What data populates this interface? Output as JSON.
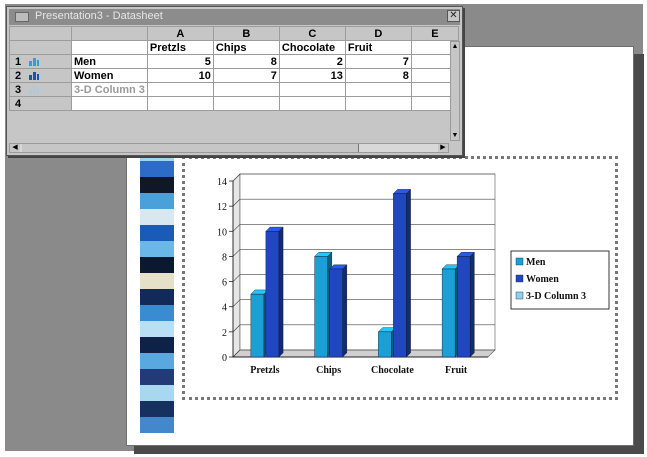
{
  "window": {
    "title": "Presentation3 - Datasheet",
    "close_glyph": "✕"
  },
  "datasheet": {
    "columns": [
      "A",
      "B",
      "C",
      "D",
      "E"
    ],
    "categories": [
      "Pretzls",
      "Chips",
      "Chocolate",
      "Fruit",
      ""
    ],
    "rows": [
      {
        "num": "1",
        "label": "Men",
        "values": [
          "5",
          "8",
          "2",
          "7",
          ""
        ],
        "color": "#29a3d6",
        "dim": false
      },
      {
        "num": "2",
        "label": "Women",
        "values": [
          "10",
          "7",
          "13",
          "8",
          ""
        ],
        "color": "#1f4fb8",
        "dim": false
      },
      {
        "num": "3",
        "label": "3-D Column 3",
        "values": [
          "",
          "",
          "",
          "",
          ""
        ],
        "color": "#8fd0ee",
        "dim": true
      },
      {
        "num": "4",
        "label": "",
        "values": [
          "",
          "",
          "",
          "",
          ""
        ],
        "color": "",
        "dim": false
      }
    ]
  },
  "stripe_colors": [
    "#9fd4f2",
    "#2c6cc8",
    "#101828",
    "#4aa0d8",
    "#d8e8f0",
    "#1a5bb8",
    "#6ab8e8",
    "#0a1830",
    "#e6e0c8",
    "#122a58",
    "#3a8cd0",
    "#b8dff4",
    "#0e2248",
    "#5aa8e0",
    "#223a78",
    "#a8d8f0",
    "#163060",
    "#4488cc"
  ],
  "chart_data": {
    "type": "bar",
    "categories": [
      "Pretzls",
      "Chips",
      "Chocolate",
      "Fruit"
    ],
    "series": [
      {
        "name": "Men",
        "values": [
          5,
          8,
          2,
          7
        ],
        "color": "#1a9fd6"
      },
      {
        "name": "Women",
        "values": [
          10,
          7,
          13,
          8
        ],
        "color": "#2047c0"
      }
    ],
    "legend": [
      "Men",
      "Women",
      "3-D Column 3"
    ],
    "legend_colors": [
      "#1a9fd6",
      "#2047c0",
      "#8fd0ee"
    ],
    "ylim": [
      0,
      14
    ],
    "yticks": [
      "0",
      "2",
      "4",
      "6",
      "8",
      "10",
      "12",
      "14"
    ],
    "grid": true,
    "legend_position": "right"
  }
}
